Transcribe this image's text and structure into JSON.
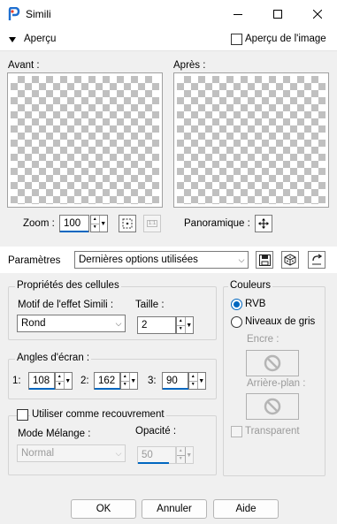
{
  "window": {
    "title": "Simili",
    "icon": "psp-app-icon"
  },
  "preview": {
    "toggle_label": "Aperçu",
    "preview_on_image_label": "Aperçu de l'image",
    "before_label": "Avant :",
    "after_label": "Après :"
  },
  "zoom": {
    "label": "Zoom :",
    "value": "100",
    "actual_size_label": "1:1",
    "pan_label": "Panoramique :"
  },
  "presets": {
    "label": "Paramètres",
    "value": "Dernières options utilisées"
  },
  "cells": {
    "group_label": "Propriétés des cellules",
    "pattern_label": "Motif de l'effet Simili :",
    "pattern_value": "Rond",
    "size_label": "Taille :",
    "size_value": "2"
  },
  "angles": {
    "group_label": "Angles d'écran :",
    "items": [
      {
        "label": "1:",
        "value": "108"
      },
      {
        "label": "2:",
        "value": "162"
      },
      {
        "label": "3:",
        "value": "90"
      }
    ]
  },
  "overlay": {
    "checkbox_label": "Utiliser comme recouvrement",
    "blend_label": "Mode Mélange :",
    "blend_value": "Normal",
    "opacity_label": "Opacité :",
    "opacity_value": "50"
  },
  "colors": {
    "group_label": "Couleurs",
    "rgb_label": "RVB",
    "gray_label": "Niveaux de gris",
    "ink_label": "Encre :",
    "background_label": "Arrière-plan :",
    "transparent_label": "Transparent",
    "accent": "#0067c0"
  },
  "buttons": {
    "ok": "OK",
    "cancel": "Annuler",
    "help": "Aide"
  }
}
